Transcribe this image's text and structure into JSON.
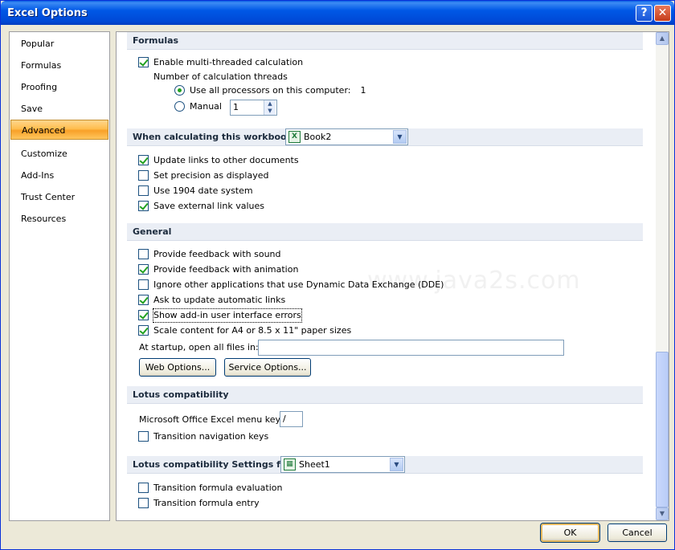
{
  "window": {
    "title": "Excel Options",
    "help_label": "?",
    "close_label": "✕"
  },
  "watermark": "www.java2s.com",
  "nav": {
    "items": [
      {
        "label": "Popular"
      },
      {
        "label": "Formulas"
      },
      {
        "label": "Proofing"
      },
      {
        "label": "Save"
      },
      {
        "label": "Advanced",
        "selected": true
      },
      {
        "label": "Customize"
      },
      {
        "label": "Add-Ins"
      },
      {
        "label": "Trust Center"
      },
      {
        "label": "Resources"
      }
    ]
  },
  "formulas": {
    "header": "Formulas",
    "multithread_label": "Enable multi-threaded calculation",
    "multithread_checked": true,
    "threads_label": "Number of calculation threads",
    "use_all_label": "Use all processors on this computer:",
    "use_all_count": "1",
    "manual_label": "Manual",
    "manual_value": "1"
  },
  "workbook": {
    "header": "When calculating this workbook:",
    "selected": "Book2",
    "options": [
      {
        "label": "Update links to other documents",
        "checked": true
      },
      {
        "label": "Set precision as displayed",
        "checked": false
      },
      {
        "label": "Use 1904 date system",
        "checked": false
      },
      {
        "label": "Save external link values",
        "checked": true
      }
    ]
  },
  "general": {
    "header": "General",
    "options": [
      {
        "label": "Provide feedback with sound",
        "checked": false
      },
      {
        "label": "Provide feedback with animation",
        "checked": true
      },
      {
        "label": "Ignore other applications that use Dynamic Data Exchange (DDE)",
        "checked": false
      },
      {
        "label": "Ask to update automatic links",
        "checked": true
      },
      {
        "label": "Show add-in user interface errors",
        "checked": true
      },
      {
        "label": "Scale content for A4 or 8.5 x 11\" paper sizes",
        "checked": true
      }
    ],
    "startup_label": "At startup, open all files in:",
    "startup_value": "",
    "web_options_label": "Web Options...",
    "service_options_label": "Service Options..."
  },
  "lotus": {
    "header": "Lotus compatibility",
    "menu_key_label": "Microsoft Office Excel menu key:",
    "menu_key_value": "/",
    "nav_keys_label": "Transition navigation keys",
    "nav_keys_checked": false
  },
  "lotus_settings": {
    "header": "Lotus compatibility Settings for:",
    "selected": "Sheet1",
    "options": [
      {
        "label": "Transition formula evaluation",
        "checked": false
      },
      {
        "label": "Transition formula entry",
        "checked": false
      }
    ]
  },
  "footer": {
    "ok_label": "OK",
    "cancel_label": "Cancel"
  },
  "colors": {
    "title_blue": "#0058e6",
    "nav_selected": "#ffbe4f",
    "check_green": "#21a121"
  }
}
